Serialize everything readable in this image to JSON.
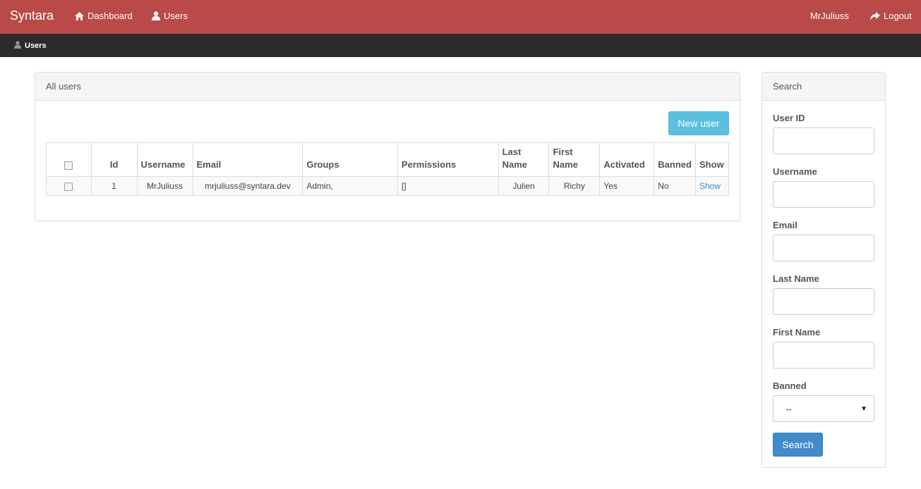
{
  "app": {
    "brand": "Syntara"
  },
  "nav": {
    "items": [
      {
        "label": "Dashboard",
        "icon": "home-icon"
      },
      {
        "label": "Users",
        "icon": "user-icon"
      }
    ],
    "right": [
      {
        "label": "MrJuliuss"
      },
      {
        "label": "Logout",
        "icon": "share-icon"
      }
    ]
  },
  "breadcrumb": {
    "label": "Users",
    "icon": "user-icon"
  },
  "users_panel": {
    "title": "All users",
    "new_user_label": "New user",
    "columns": [
      "Id",
      "Username",
      "Email",
      "Groups",
      "Permissions",
      "Last Name",
      "First Name",
      "Activated",
      "Banned",
      "Show"
    ],
    "rows": [
      {
        "id": "1",
        "username": "MrJuliuss",
        "email": "mrjuliuss@syntara.dev",
        "groups": "Admin,",
        "permissions": "[]",
        "last_name": "Julien",
        "first_name": "Richy",
        "activated": "Yes",
        "banned": "No",
        "show": "Show"
      }
    ]
  },
  "search_panel": {
    "title": "Search",
    "fields": [
      {
        "label": "User ID",
        "value": ""
      },
      {
        "label": "Username",
        "value": ""
      },
      {
        "label": "Email",
        "value": ""
      },
      {
        "label": "Last Name",
        "value": ""
      },
      {
        "label": "First Name",
        "value": ""
      }
    ],
    "banned": {
      "label": "Banned",
      "selected": "--"
    },
    "submit_label": "Search"
  },
  "colors": {
    "navbar": "#b94a48",
    "subbar": "#2b2b2b",
    "info_button": "#5bc0de",
    "primary_button": "#428bca",
    "link": "#428bca"
  }
}
